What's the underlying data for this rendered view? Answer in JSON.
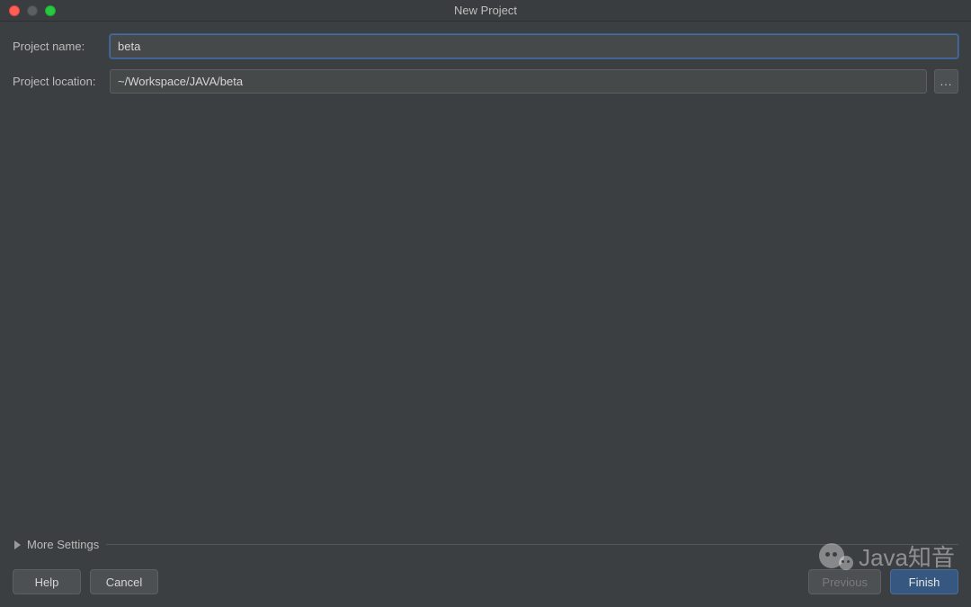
{
  "window": {
    "title": "New Project"
  },
  "form": {
    "project_name_label": "Project name:",
    "project_name_value": "beta",
    "project_location_label": "Project location:",
    "project_location_value": "~/Workspace/JAVA/beta",
    "browse_label": "..."
  },
  "more_settings": {
    "label": "More Settings"
  },
  "footer": {
    "help": "Help",
    "cancel": "Cancel",
    "previous": "Previous",
    "finish": "Finish"
  },
  "watermark": {
    "text": "Java知音"
  }
}
